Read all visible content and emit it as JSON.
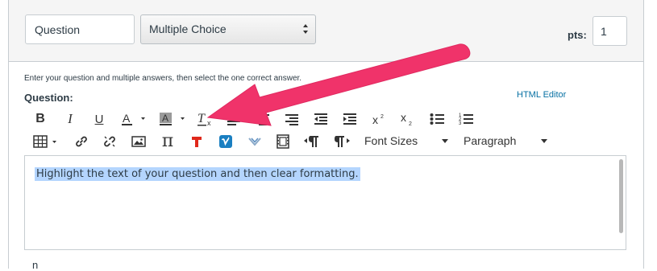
{
  "header": {
    "title_value": "Question",
    "type_selected": "Multiple Choice",
    "pts_label": "pts:",
    "pts_value": "1"
  },
  "body": {
    "instructions": "Enter your question and multiple answers, then select the one correct answer.",
    "question_label": "Question:",
    "html_editor_link": "HTML Editor"
  },
  "toolbar": {
    "row1": [
      "bold-icon",
      "italic-icon",
      "underline-icon",
      "text-color-icon",
      "background-color-icon",
      "clear-formatting-icon",
      "align-left-icon",
      "align-center-icon",
      "align-right-icon",
      "outdent-icon",
      "indent-icon",
      "superscript-icon",
      "subscript-icon",
      "bullet-list-icon",
      "numbered-list-icon"
    ],
    "row2": [
      "table-icon",
      "link-icon",
      "unlink-icon",
      "image-icon",
      "math-pi-icon",
      "text-tool-icon",
      "vimeo-icon",
      "chevron-tool-icon",
      "media-icon",
      "ltr-paragraph-icon",
      "rtl-paragraph-icon"
    ],
    "font_sizes_label": "Font Sizes",
    "paragraph_label": "Paragraph"
  },
  "editor": {
    "content": "Highlight the text of your question and then clear formatting."
  },
  "footer": {
    "partial_text": "n"
  },
  "colors": {
    "accent_link": "#0770a3",
    "arrow": "#f0336a",
    "selection": "#b4d5fe",
    "text_tool_red": "#e0281b",
    "vimeo_blue": "#1a7fc1"
  }
}
